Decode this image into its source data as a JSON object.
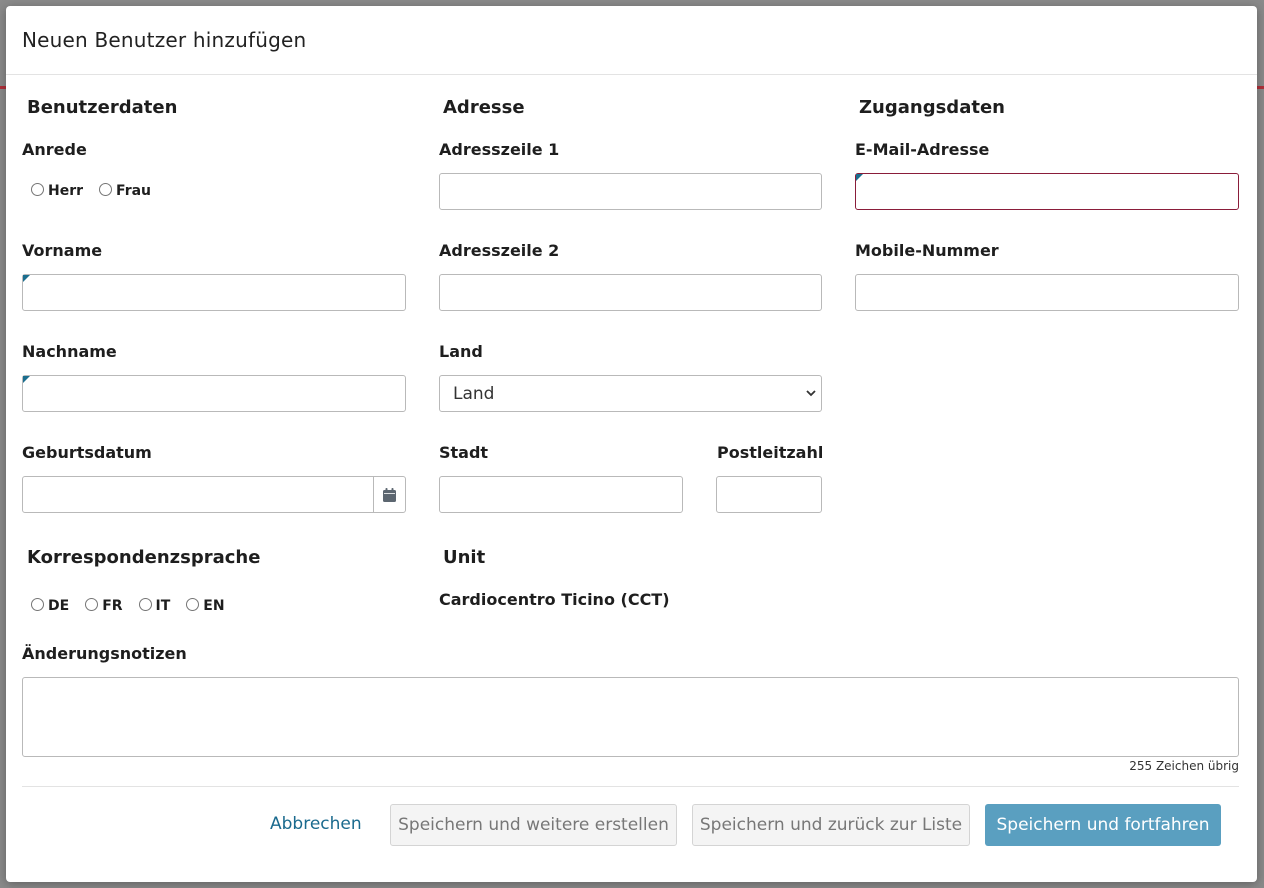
{
  "modal": {
    "title": "Neuen Benutzer hinzufügen"
  },
  "user_data": {
    "section_title": "Benutzerdaten",
    "salutation_label": "Anrede",
    "salutation_options": [
      "Herr",
      "Frau"
    ],
    "firstname_label": "Vorname",
    "firstname_value": "",
    "lastname_label": "Nachname",
    "lastname_value": "",
    "birthdate_label": "Geburtsdatum",
    "birthdate_value": ""
  },
  "address": {
    "section_title": "Adresse",
    "line1_label": "Adresszeile 1",
    "line1_value": "",
    "line2_label": "Adresszeile 2",
    "line2_value": "",
    "country_label": "Land",
    "country_selected": "Land",
    "city_label": "Stadt",
    "city_value": "",
    "zip_label": "Postleitzahl",
    "zip_value": ""
  },
  "access": {
    "section_title": "Zugangsdaten",
    "email_label": "E-Mail-Adresse",
    "email_value": "",
    "mobile_label": "Mobile-Nummer",
    "mobile_value": ""
  },
  "language": {
    "section_title": "Korrespondenzsprache",
    "options": [
      "DE",
      "FR",
      "IT",
      "EN"
    ]
  },
  "unit": {
    "section_title": "Unit",
    "value": "Cardiocentro Ticino (CCT)"
  },
  "notes": {
    "label": "Änderungsnotizen",
    "value": "",
    "counter": "255 Zeichen übrig"
  },
  "actions": {
    "cancel": "Abbrechen",
    "save_new": "Speichern und weitere erstellen",
    "save_back": "Speichern und zurück zur Liste",
    "save_continue": "Speichern und fortfahren"
  },
  "colors": {
    "primary_button": "#5a9fc0",
    "link": "#1a6a8e",
    "required_marker": "#1b6e8e",
    "invalid_border": "#8a1d3a"
  },
  "icons": {
    "calendar": "calendar-icon",
    "select_chevron": "chevron-down-icon"
  }
}
